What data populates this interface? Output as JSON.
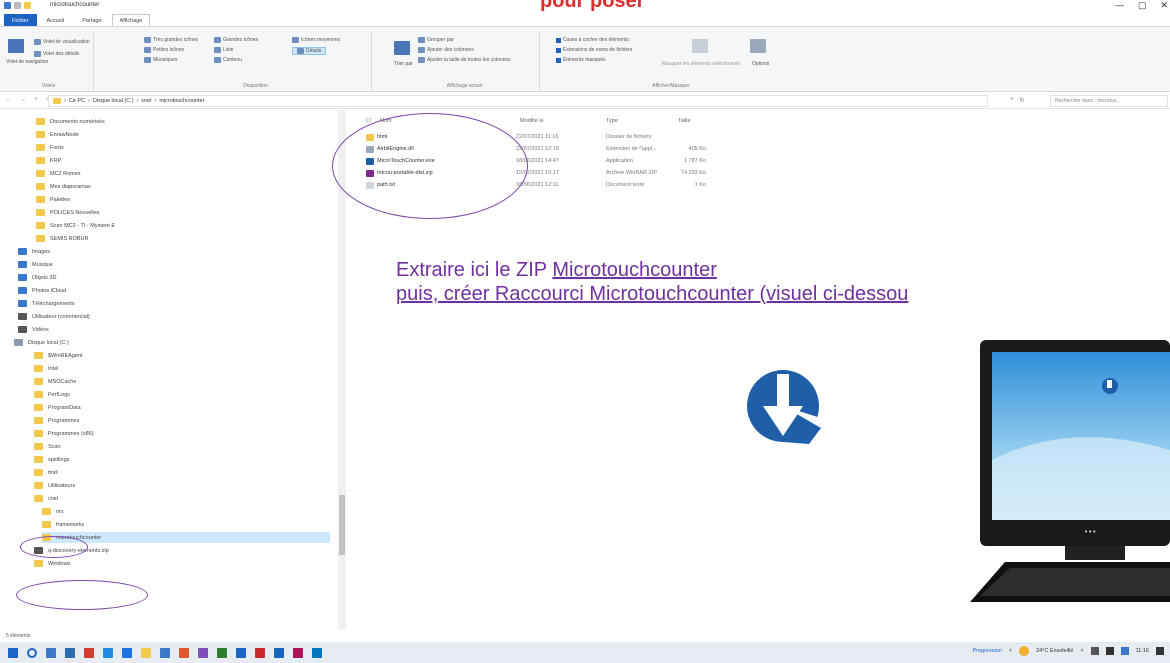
{
  "window": {
    "title": "microtouchcounter",
    "banner": "pour poser",
    "controls": [
      "—",
      "▢",
      "✕"
    ]
  },
  "tabs": [
    "Fichier",
    "Accueil",
    "Partage",
    "Affichage"
  ],
  "ribbon": {
    "groups": [
      {
        "label": "Volets",
        "items": [
          "Volet de navigation",
          "Volet de visualisation",
          "Volet des détails"
        ]
      },
      {
        "label": "Disposition",
        "items": [
          "Très grandes icônes",
          "Grandes icônes",
          "Icônes moyennes",
          "Petites icônes",
          "Liste",
          "Détails",
          "Mosaïques",
          "Contenu"
        ]
      },
      {
        "label": "Affichage actuel",
        "items": [
          "Grouper par",
          "Ajouter des colonnes",
          "Ajuster la taille de toutes les colonnes",
          "Trier par"
        ]
      },
      {
        "label": "Afficher/Masquer",
        "items": [
          "Cases à cocher des éléments",
          "Extensions de noms de fichiers",
          "Éléments masqués",
          "Masquer les éléments sélectionnés",
          "Options"
        ]
      }
    ]
  },
  "address": {
    "path": [
      "Ce PC",
      "Disque local (C:)",
      "cnel",
      "microtouchcounter"
    ],
    "search_placeholder": "Rechercher dans : microtou..."
  },
  "sidebar": {
    "items": [
      {
        "label": "Documents numérisés",
        "kind": "folder"
      },
      {
        "label": "EnrawNode",
        "kind": "folder"
      },
      {
        "label": "Fonts",
        "kind": "folder"
      },
      {
        "label": "KRP",
        "kind": "folder"
      },
      {
        "label": "MC2 Romes",
        "kind": "folder"
      },
      {
        "label": "Mes diaporamas",
        "kind": "folder"
      },
      {
        "label": "Palettes",
        "kind": "folder"
      },
      {
        "label": "POLICES Nouvelles",
        "kind": "folder"
      },
      {
        "label": "Scan MC2 - TI - Mystere E",
        "kind": "folder"
      },
      {
        "label": "SEMIS ROBUR",
        "kind": "folder"
      },
      {
        "label": "Images",
        "kind": "blue"
      },
      {
        "label": "Musique",
        "kind": "blue"
      },
      {
        "label": "Objets 3D",
        "kind": "blue"
      },
      {
        "label": "Photos iCloud",
        "kind": "blue"
      },
      {
        "label": "Téléchargements",
        "kind": "blue"
      },
      {
        "label": "Utilisateur (commercial)",
        "kind": "dark"
      },
      {
        "label": "Vidéos",
        "kind": "dark"
      },
      {
        "label": "Disque local (C:)",
        "kind": "drive"
      },
      {
        "label": "$WinREAgent",
        "kind": "folder"
      },
      {
        "label": "Intel",
        "kind": "folder"
      },
      {
        "label": "MSOCache",
        "kind": "folder"
      },
      {
        "label": "PerfLogs",
        "kind": "folder"
      },
      {
        "label": "ProgramData",
        "kind": "folder"
      },
      {
        "label": "Programmes",
        "kind": "folder"
      },
      {
        "label": "Programmes (x86)",
        "kind": "folder"
      },
      {
        "label": "Scan",
        "kind": "folder"
      },
      {
        "label": "spellings",
        "kind": "folder"
      },
      {
        "label": "tmill",
        "kind": "folder"
      },
      {
        "label": "Utilisateurs",
        "kind": "folder"
      },
      {
        "label": "cnel",
        "kind": "folder"
      },
      {
        "label": "rirs",
        "kind": "folder"
      },
      {
        "label": "frameworks",
        "kind": "folder"
      },
      {
        "label": "microtouchcounter",
        "kind": "folder",
        "selected": true
      },
      {
        "label": "q-discovery-elements.zip",
        "kind": "dark"
      },
      {
        "label": "Windows",
        "kind": "folder"
      }
    ]
  },
  "file_list": {
    "headers": [
      "Nom",
      "Modifié le",
      "Type",
      "Taille"
    ],
    "rows": [
      {
        "name": "html",
        "date": "22/07/2021 11:16",
        "type": "Dossier de fichiers",
        "size": "",
        "icon": "folder"
      },
      {
        "name": "AirbitEngine.dll",
        "date": "22/07/2021 12:18",
        "type": "Extension de l'appl...",
        "size": "405 Ko",
        "icon": "dll"
      },
      {
        "name": "MicroTouchCounter.exe",
        "date": "18/06/2021 14:47",
        "type": "Application",
        "size": "1 787 Ko",
        "icon": "exe"
      },
      {
        "name": "mtcou-portable-dist.zip",
        "date": "15/07/2021 10:17",
        "type": "Archive WinRAR ZIP",
        "size": "74 233 Ko",
        "icon": "zip"
      },
      {
        "name": "path.txt",
        "date": "18/08/2021 12:11",
        "type": "Document texte",
        "size": "1 Ko",
        "icon": "txt"
      }
    ]
  },
  "instructions": {
    "line1_prefix": "Extraire ici le ZIP ",
    "line1_link": "Microtouchcounter",
    "line2": "puis, créer Raccourci Microtouchcounter (visuel ci-dessou"
  },
  "status_bar": "5 éléments",
  "taskbar": {
    "weather": "24°C Ensoleillé",
    "label": "Progression",
    "time": "11:16"
  },
  "colors": {
    "accent": "#1c64c4",
    "instruction_text": "#7030a0",
    "circle": "#7b4aa8",
    "logo_blue": "#1f5fa8",
    "banner_red": "#e12a2a"
  }
}
